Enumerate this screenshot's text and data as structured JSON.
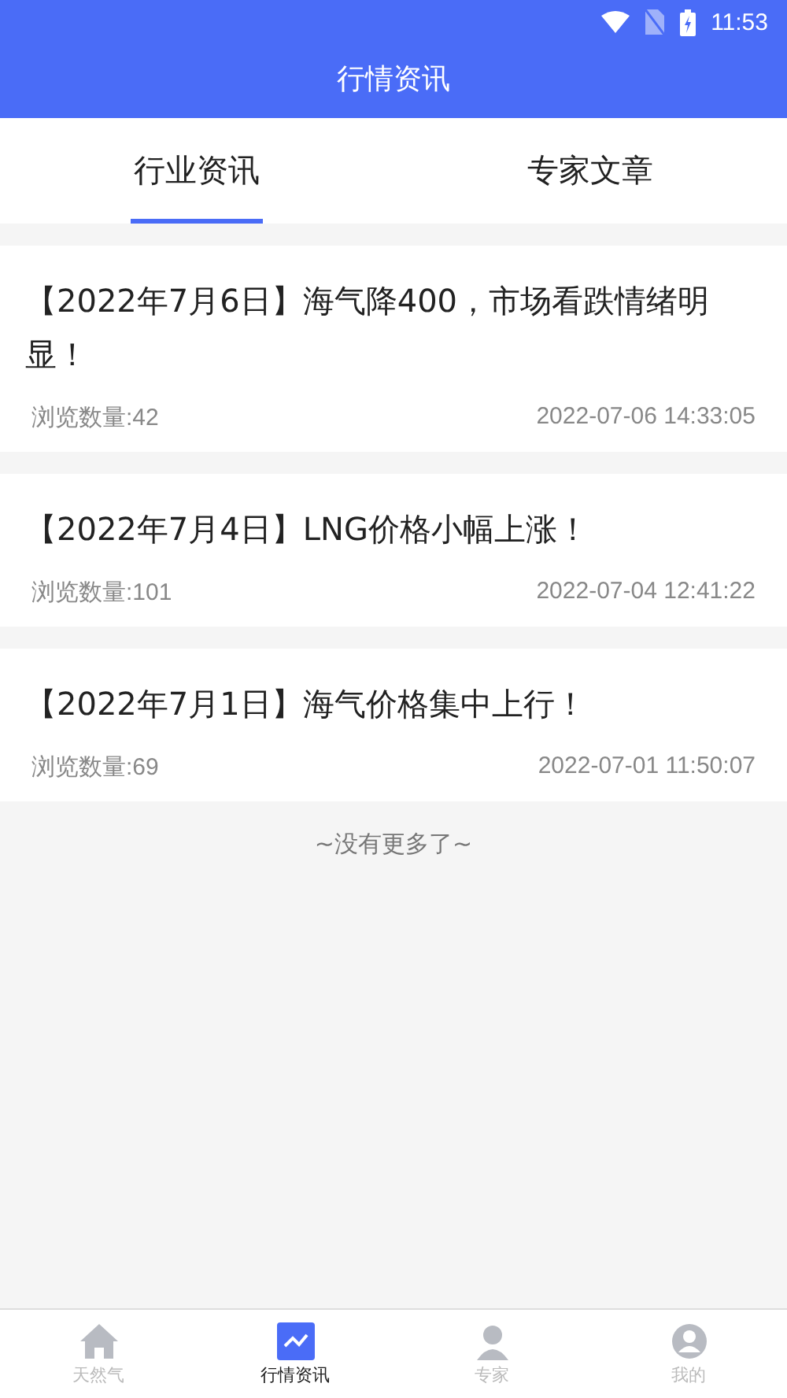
{
  "status_bar": {
    "time": "11:53"
  },
  "header": {
    "title": "行情资讯"
  },
  "tabs": [
    {
      "label": "行业资讯",
      "selected": true
    },
    {
      "label": "专家文章",
      "selected": false
    }
  ],
  "articles": [
    {
      "title": "【2022年7月6日】海气降400，市场看跌情绪明显！",
      "views": "浏览数量:42",
      "time": "2022-07-06 14:33:05"
    },
    {
      "title": "【2022年7月4日】LNG价格小幅上涨！",
      "views": "浏览数量:101",
      "time": "2022-07-04 12:41:22"
    },
    {
      "title": "【2022年7月1日】海气价格集中上行！",
      "views": "浏览数量:69",
      "time": "2022-07-01 11:50:07"
    }
  ],
  "end_note": "~没有更多了~",
  "bottom_nav": [
    {
      "label": "天然气",
      "kind": "home",
      "selected": false
    },
    {
      "label": "行情资讯",
      "kind": "chart",
      "selected": true
    },
    {
      "label": "专家",
      "kind": "expert",
      "selected": false
    },
    {
      "label": "我的",
      "kind": "profile",
      "selected": false
    }
  ]
}
